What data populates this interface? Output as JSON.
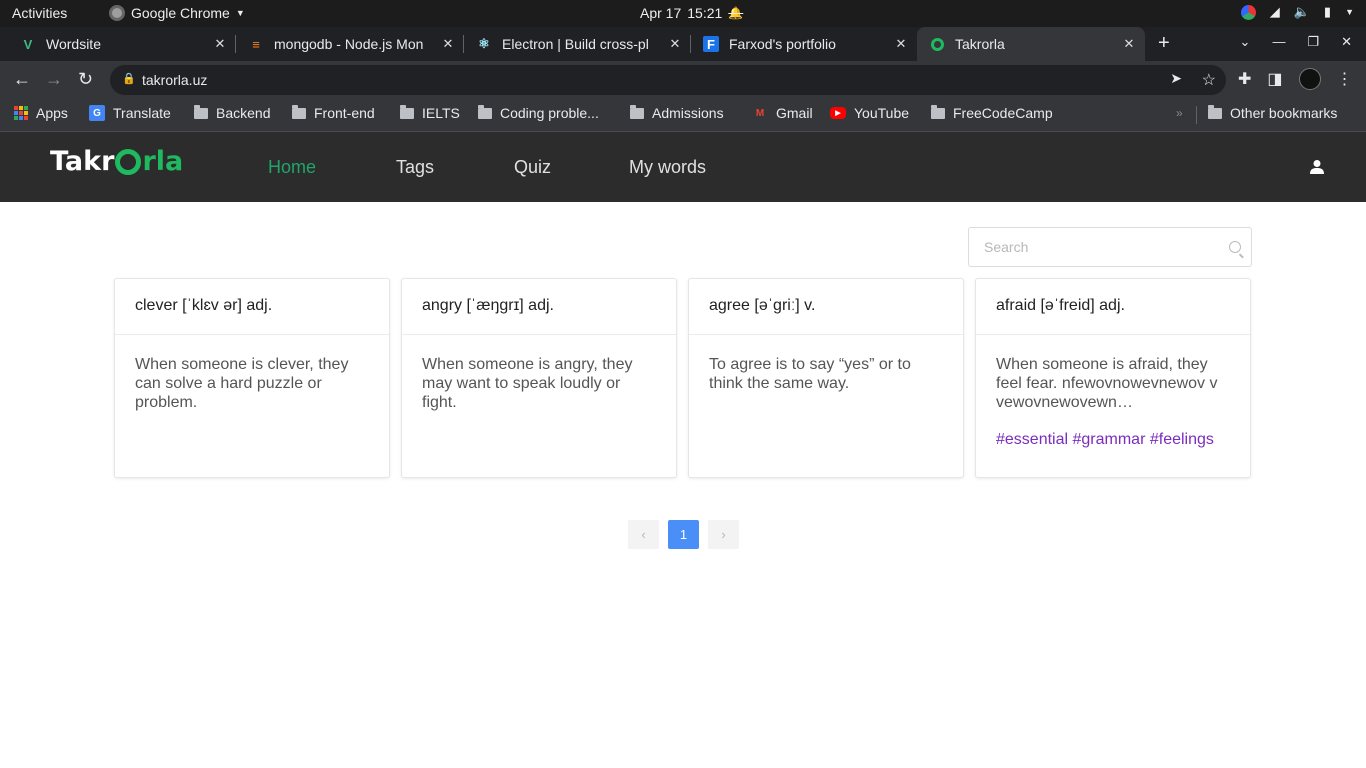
{
  "system_bar": {
    "activities": "Activities",
    "app_name": "Google Chrome",
    "date": "Apr 17",
    "time": "15:21"
  },
  "tabs": [
    {
      "title": "Wordsite",
      "icon": "vue-icon",
      "color": "#41b883"
    },
    {
      "title": "mongodb - Node.js Mon",
      "icon": "stackoverflow-icon",
      "color": "#f48024"
    },
    {
      "title": "Electron | Build cross-pl",
      "icon": "electron-icon",
      "color": "#9feaf9"
    },
    {
      "title": "Farxod's portfolio",
      "icon": "f-icon",
      "color": "#1a73e8"
    },
    {
      "title": "Takrorla",
      "icon": "takrorla-icon",
      "color": "#1fb960"
    }
  ],
  "address_bar": {
    "url": "takrorla.uz"
  },
  "bookmarks": [
    {
      "label": "Apps",
      "type": "apps"
    },
    {
      "label": "Translate",
      "type": "translate"
    },
    {
      "label": "Backend",
      "type": "folder"
    },
    {
      "label": "Front-end",
      "type": "folder"
    },
    {
      "label": "IELTS",
      "type": "folder"
    },
    {
      "label": "Coding proble...",
      "type": "folder"
    },
    {
      "label": "Admissions",
      "type": "folder"
    },
    {
      "label": "Gmail",
      "type": "gmail"
    },
    {
      "label": "YouTube",
      "type": "youtube"
    },
    {
      "label": "FreeCodeCamp",
      "type": "folder"
    },
    {
      "label": "Other bookmarks",
      "type": "folder"
    }
  ],
  "site": {
    "logo": {
      "part1": "Takr",
      "part2": "rla"
    },
    "nav": [
      "Home",
      "Tags",
      "Quiz",
      "My words"
    ],
    "accent": "#21a46b",
    "search_placeholder": "Search",
    "cards": [
      {
        "word": "clever [ˈklɛv ər] adj.",
        "definition": "When someone is clever, they can solve a hard puzzle or problem.",
        "tags": ""
      },
      {
        "word": "angry [ˈæŋgrɪ] adj.",
        "definition": "When someone is angry, they may want to speak loudly or fight.",
        "tags": ""
      },
      {
        "word": "agree [əˈgriː] v.",
        "definition": "To agree is to say “yes” or to think the same way.",
        "tags": ""
      },
      {
        "word": "afraid [əˈfreid] adj.",
        "definition": "When someone is afraid, they feel fear. nfewovnowevnewov v vewovnewovewn vewvenvewewewevwew",
        "tags": "#essential #grammar #feelings"
      }
    ],
    "pagination": {
      "current": "1",
      "prev": "‹",
      "next": "›"
    }
  }
}
